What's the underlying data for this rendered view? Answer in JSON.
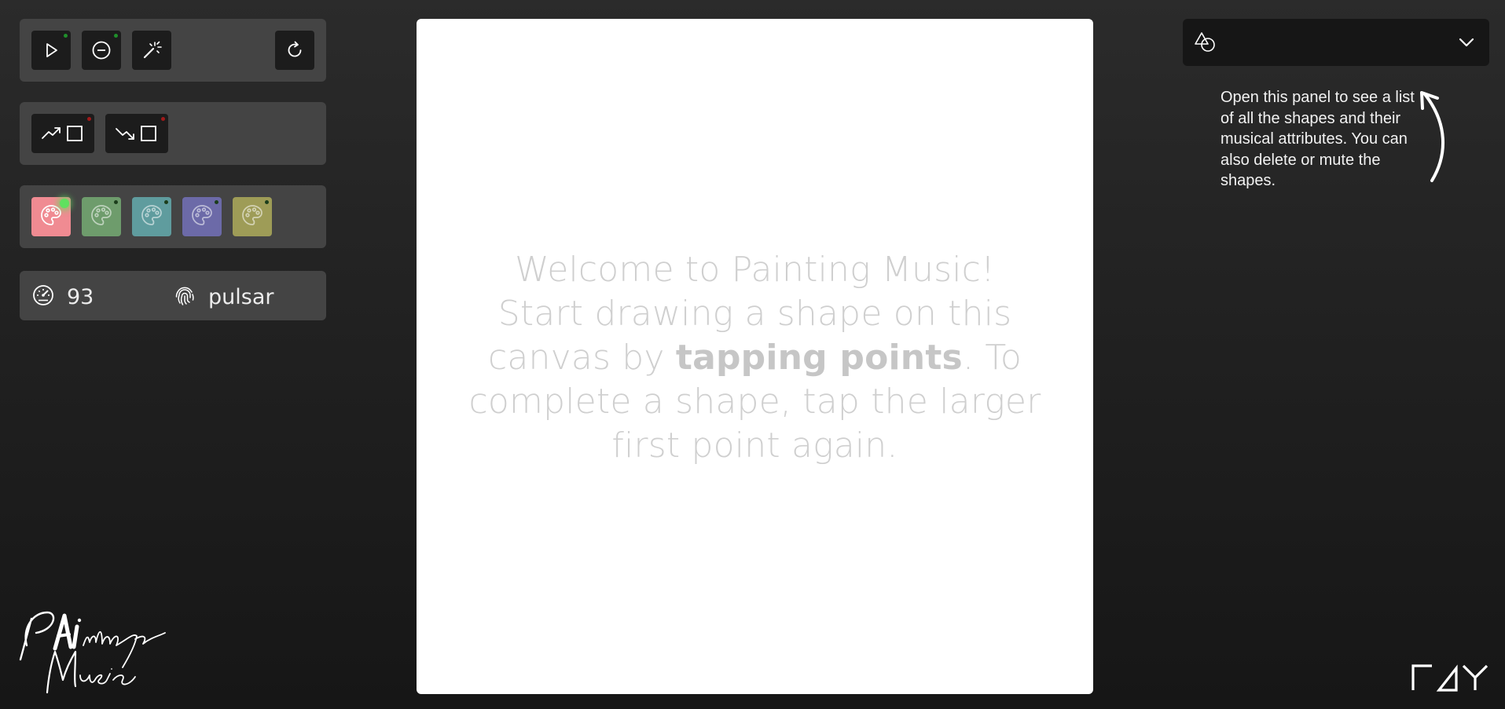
{
  "toolbar": {
    "play": {
      "icon": "play-icon",
      "indicator_color": "#1f8f2a"
    },
    "mute": {
      "icon": "circle-minus-icon",
      "indicator_color": "#1f8f2a"
    },
    "magic": {
      "icon": "magic-wand-icon"
    },
    "reset": {
      "icon": "rotate-icon"
    }
  },
  "shape_modes": [
    {
      "icon": "trend-up-square-icon",
      "indicator_color": "#a01a1a"
    },
    {
      "icon": "trend-down-square-icon",
      "indicator_color": "#a01a1a"
    }
  ],
  "palettes": [
    {
      "color": "#f08b92",
      "icon": "palette-icon",
      "active": true,
      "indicator_color": "#5fe05f"
    },
    {
      "color": "#6e9c6c",
      "icon": "palette-icon",
      "active": false,
      "indicator_color": "#1b3d1b"
    },
    {
      "color": "#5f9c9e",
      "icon": "palette-icon",
      "active": false,
      "indicator_color": "#1b3d1b"
    },
    {
      "color": "#6c6aa8",
      "icon": "palette-icon",
      "active": false,
      "indicator_color": "#1b3d1b"
    },
    {
      "color": "#9e9c57",
      "icon": "palette-icon",
      "active": false,
      "indicator_color": "#1b3d1b"
    }
  ],
  "settings": {
    "tempo_icon": "speedometer-icon",
    "tempo": "93",
    "instrument_icon": "fingerprint-icon",
    "instrument": "pulsar"
  },
  "canvas": {
    "welcome_line1": "Welcome to Painting Music!",
    "welcome_line2": "Start drawing a shape on this",
    "welcome_line3_pre": "canvas by ",
    "welcome_bold": "tapping points",
    "welcome_line3_post": ". To",
    "welcome_line4": "complete a shape, tap the larger",
    "welcome_line5": "first point again."
  },
  "shapes_panel": {
    "icon": "shapes-icon",
    "chevron": "chevron-down-icon",
    "hint": "Open this panel to see a list of all the shapes and their musical attributes. You can also delete or mute the shapes."
  },
  "branding": {
    "logo_text": "PAinting Music",
    "footer_logo": "RAY"
  }
}
